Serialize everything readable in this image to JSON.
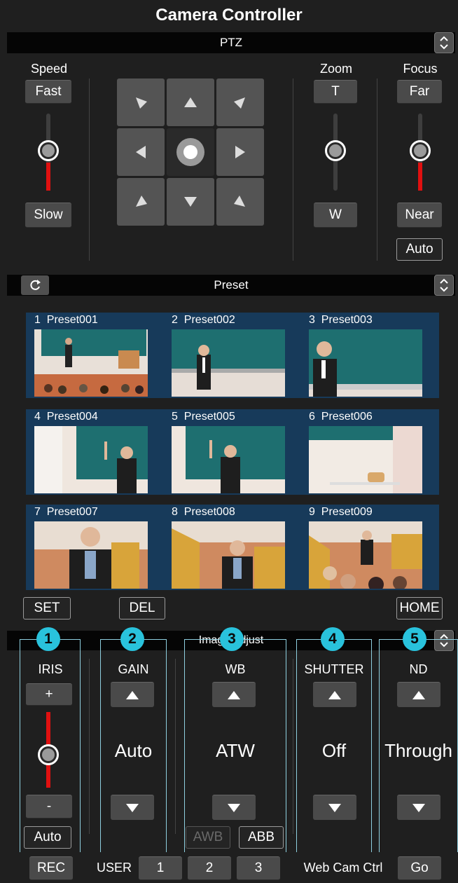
{
  "app": {
    "title": "Camera Controller"
  },
  "ptz": {
    "section_title": "PTZ",
    "speed": {
      "label": "Speed",
      "fast": "Fast",
      "slow": "Slow"
    },
    "zoom": {
      "label": "Zoom",
      "tele": "T",
      "wide": "W"
    },
    "focus": {
      "label": "Focus",
      "far": "Far",
      "near": "Near",
      "auto": "Auto"
    }
  },
  "preset": {
    "section_title": "Preset",
    "items": [
      {
        "num": "1",
        "name": "Preset001"
      },
      {
        "num": "2",
        "name": "Preset002"
      },
      {
        "num": "3",
        "name": "Preset003"
      },
      {
        "num": "4",
        "name": "Preset004"
      },
      {
        "num": "5",
        "name": "Preset005"
      },
      {
        "num": "6",
        "name": "Preset006"
      },
      {
        "num": "7",
        "name": "Preset007"
      },
      {
        "num": "8",
        "name": "Preset008"
      },
      {
        "num": "9",
        "name": "Preset009"
      }
    ],
    "set_label": "SET",
    "del_label": "DEL",
    "home_label": "HOME"
  },
  "image_adjust": {
    "section_title": "Image Adjust",
    "badges": [
      "1",
      "2",
      "3",
      "4",
      "5"
    ],
    "iris": {
      "label": "IRIS",
      "plus": "+",
      "minus": "-",
      "auto": "Auto"
    },
    "gain": {
      "label": "GAIN",
      "value": "Auto"
    },
    "wb": {
      "label": "WB",
      "value": "ATW",
      "awb": "AWB",
      "abb": "ABB"
    },
    "shutter": {
      "label": "SHUTTER",
      "value": "Off"
    },
    "nd": {
      "label": "ND",
      "value": "Through"
    }
  },
  "bottom": {
    "rec": "REC",
    "user_label": "USER",
    "user_buttons": [
      "1",
      "2",
      "3"
    ],
    "webcam_label": "Web Cam Ctrl",
    "go": "Go"
  },
  "colors": {
    "background": "#1f1f1f",
    "bar": "#050505",
    "button": "#4a4a4a",
    "preset_bg": "#173a5a",
    "badge": "#29c2dc",
    "slider_red": "#e01010",
    "highlight_box": "#8fd0e0"
  }
}
